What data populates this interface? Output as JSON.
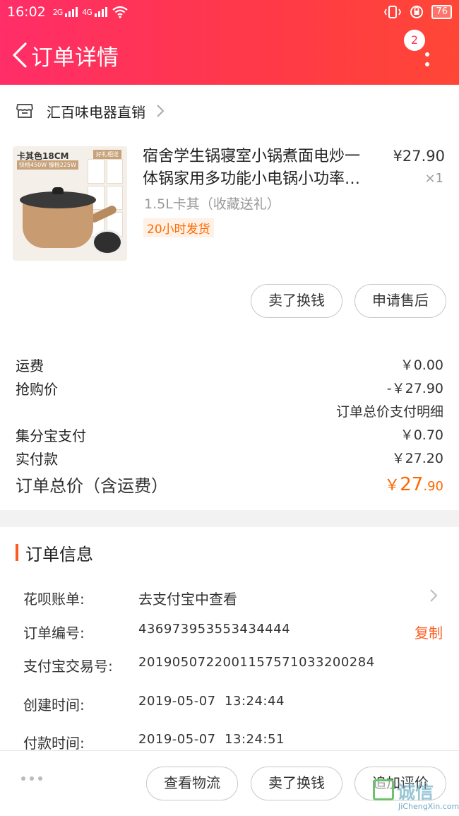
{
  "status_bar": {
    "time": "16:02",
    "signal1": "2G",
    "signal2": "4G",
    "battery": "76"
  },
  "header": {
    "title": "订单详情",
    "badge_count": "2",
    "bg_colors": [
      "#ff2d68",
      "#ff4636"
    ]
  },
  "shop": {
    "name": "汇百味电器直销"
  },
  "product": {
    "title_line1": "宿舍学生锅寝室小锅煮面电炒一",
    "title_line2": "体锅家用多功能小电锅小功率…",
    "price": "¥27.90",
    "qty": "×1",
    "sku": "1.5L卡其（收藏送礼）",
    "tag": "20小时发货",
    "thumb_text1": "卡其色18CM",
    "thumb_text2": "快档450W 慢档225W",
    "thumb_text3": "好礼相送"
  },
  "product_actions": {
    "sell": "卖了换钱",
    "after_sales": "申请售后"
  },
  "fees": {
    "shipping_label": "运费",
    "shipping_value": "￥0.00",
    "flash_label": "抢购价",
    "flash_value": "-￥27.90",
    "detail_link": "订单总价支付明细",
    "jifenbao_label": "集分宝支付",
    "jifenbao_value": "￥0.70",
    "paid_label": "实付款",
    "paid_value": "￥27.20",
    "total_label": "订单总价（含运费）",
    "total_currency": "￥",
    "total_int": "27",
    "total_dec": ".90",
    "accent_color": "#ff6600"
  },
  "order_info": {
    "heading": "订单信息",
    "huabei_label": "花呗账单:",
    "huabei_value": "去支付宝中查看",
    "order_no_label": "订单编号:",
    "order_no_value": "436973953553434444",
    "copy_label": "复制",
    "alipay_label": "支付宝交易号:",
    "alipay_value": "2019050722001157571033200284",
    "created_label": "创建时间:",
    "created_value": "2019-05-07  13:24:44",
    "paid_label": "付款时间:",
    "paid_value": "2019-05-07  13:24:51"
  },
  "bottom_bar": {
    "logistics": "查看物流",
    "sell": "卖了换钱",
    "review": "追加评价"
  },
  "watermark": {
    "cn": "诚信",
    "en": "JiChengXin.com"
  }
}
